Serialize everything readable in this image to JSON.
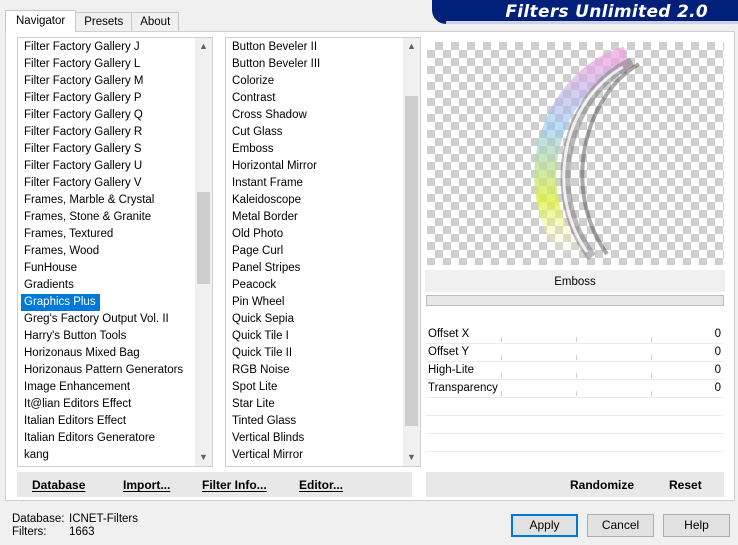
{
  "tabs": [
    "Navigator",
    "Presets",
    "About"
  ],
  "banner": "Filters Unlimited 2.0",
  "categories": [
    "Filter Factory Gallery J",
    "Filter Factory Gallery L",
    "Filter Factory Gallery M",
    "Filter Factory Gallery P",
    "Filter Factory Gallery Q",
    "Filter Factory Gallery R",
    "Filter Factory Gallery S",
    "Filter Factory Gallery U",
    "Filter Factory Gallery V",
    "Frames, Marble & Crystal",
    "Frames, Stone & Granite",
    "Frames, Textured",
    "Frames, Wood",
    "FunHouse",
    "Gradients",
    "Graphics Plus",
    "Greg's Factory Output Vol. II",
    "Harry's Button Tools",
    "Horizonaus Mixed Bag",
    "Horizonaus Pattern Generators",
    "Image Enhancement",
    "It@lian Editors Effect",
    "Italian Editors Effect",
    "Italian Editors Generatore",
    "kang",
    "..."
  ],
  "categories_selected": "Graphics Plus",
  "filters": [
    "Button Beveler II",
    "Button Beveler III",
    "Colorize",
    "Contrast",
    "Cross Shadow",
    "Cut Glass",
    "Emboss",
    "Horizontal Mirror",
    "Instant Frame",
    "Kaleidoscope",
    "Metal Border",
    "Old Photo",
    "Page Curl",
    "Panel Stripes",
    "Peacock",
    "Pin Wheel",
    "Quick Sepia",
    "Quick Tile I",
    "Quick Tile II",
    "RGB Noise",
    "Spot Lite",
    "Star Lite",
    "Tinted Glass",
    "Vertical Blinds",
    "Vertical Mirror",
    "..."
  ],
  "filter_selected": "Emboss",
  "filter_name": "Emboss",
  "params": [
    {
      "label": "Offset X",
      "value": "0"
    },
    {
      "label": "Offset Y",
      "value": "0"
    },
    {
      "label": "High-Lite",
      "value": "0"
    },
    {
      "label": "Transparency",
      "value": "0"
    }
  ],
  "left_buttons": [
    "Database",
    "Import...",
    "Filter Info...",
    "Editor..."
  ],
  "right_buttons": [
    "Randomize",
    "Reset"
  ],
  "status": {
    "database_label": "Database:",
    "database_value": "ICNET-Filters",
    "filters_label": "Filters:",
    "filters_value": "1663"
  },
  "dialog_buttons": [
    "Apply",
    "Cancel",
    "Help"
  ],
  "colors": {
    "banner_bg": "#00207a",
    "selection": "#0078d7",
    "panel_bg": "#f0f0f0"
  }
}
